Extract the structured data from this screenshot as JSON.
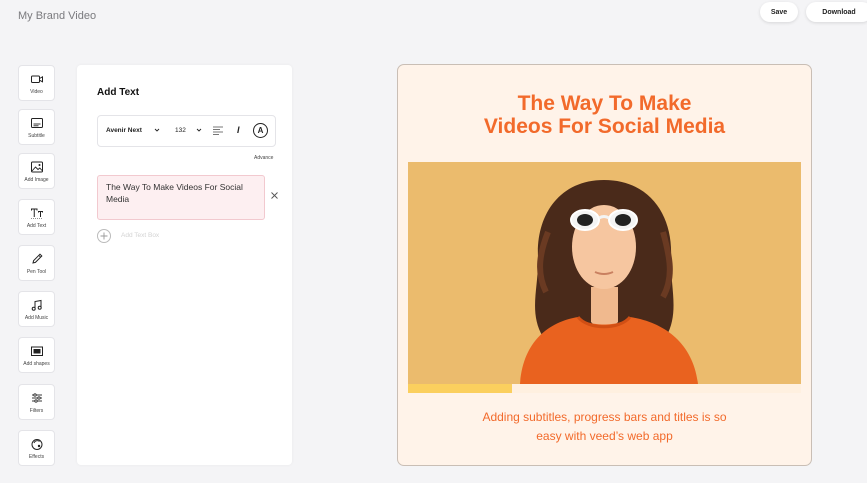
{
  "app": {
    "project_title": "My Brand Video"
  },
  "header": {
    "save_label": "Save",
    "download_label": "Download"
  },
  "sidebar": {
    "items": [
      {
        "label": "Video",
        "icon": "video-camera-icon"
      },
      {
        "label": "Subtitle",
        "icon": "subtitle-icon"
      },
      {
        "label": "Add Image",
        "icon": "image-icon"
      },
      {
        "label": "Add Text",
        "icon": "text-icon"
      },
      {
        "label": "Pen Tool",
        "icon": "pen-icon"
      },
      {
        "label": "Add Music",
        "icon": "music-note-icon"
      },
      {
        "label": "Add shapes",
        "icon": "shapes-icon"
      },
      {
        "label": "Filters",
        "icon": "sliders-icon"
      },
      {
        "label": "Effects",
        "icon": "effects-icon"
      }
    ]
  },
  "panel": {
    "title": "Add Text",
    "font_name": "Avenir Next",
    "font_size": "132",
    "italic_glyph": "I",
    "color_glyph": "A",
    "advance_label": "Advance",
    "text_box_value": "The Way To Make Videos For Social Media",
    "add_text_box_label": "Add Text Box"
  },
  "canvas": {
    "title_line1": "The Way To Make",
    "title_line2": "Videos For Social Media",
    "subtitle_line1": "Adding subtitles, progress bars and titles is so",
    "subtitle_line2": "easy with veed’s web app",
    "progress": 0.265,
    "colors": {
      "accent": "#f26a2b",
      "background": "#fff3e9",
      "progress": "#fbcf5e",
      "photo_bg": "#e9b766"
    }
  }
}
